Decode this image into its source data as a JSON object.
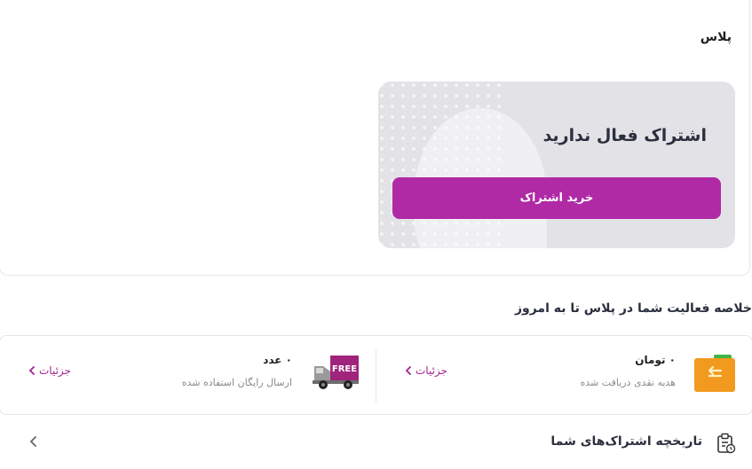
{
  "header": {
    "title": "پلاس"
  },
  "subscription": {
    "status_text": "اشتراک فعال ندارید",
    "buy_label": "خرید اشتراک"
  },
  "summary": {
    "title": "خلاصه فعالیت شما در پلاس تا به امروز"
  },
  "stats": [
    {
      "value": "۰ تومان",
      "description": "هدیه نقدی دریافت شده",
      "details_label": "جزئیات",
      "icon": "cash-return-icon"
    },
    {
      "value": "۰ عدد",
      "description": "ارسال رایگان استفاده شده",
      "details_label": "جزئیات",
      "icon": "free-shipping-truck-icon",
      "icon_text": "FREE"
    }
  ],
  "history": {
    "label": "تاریخچه اشتراک‌های شما"
  },
  "colors": {
    "accent": "#b02aa6",
    "link": "#a4238f",
    "panel_bg": "#e3e3e7"
  }
}
